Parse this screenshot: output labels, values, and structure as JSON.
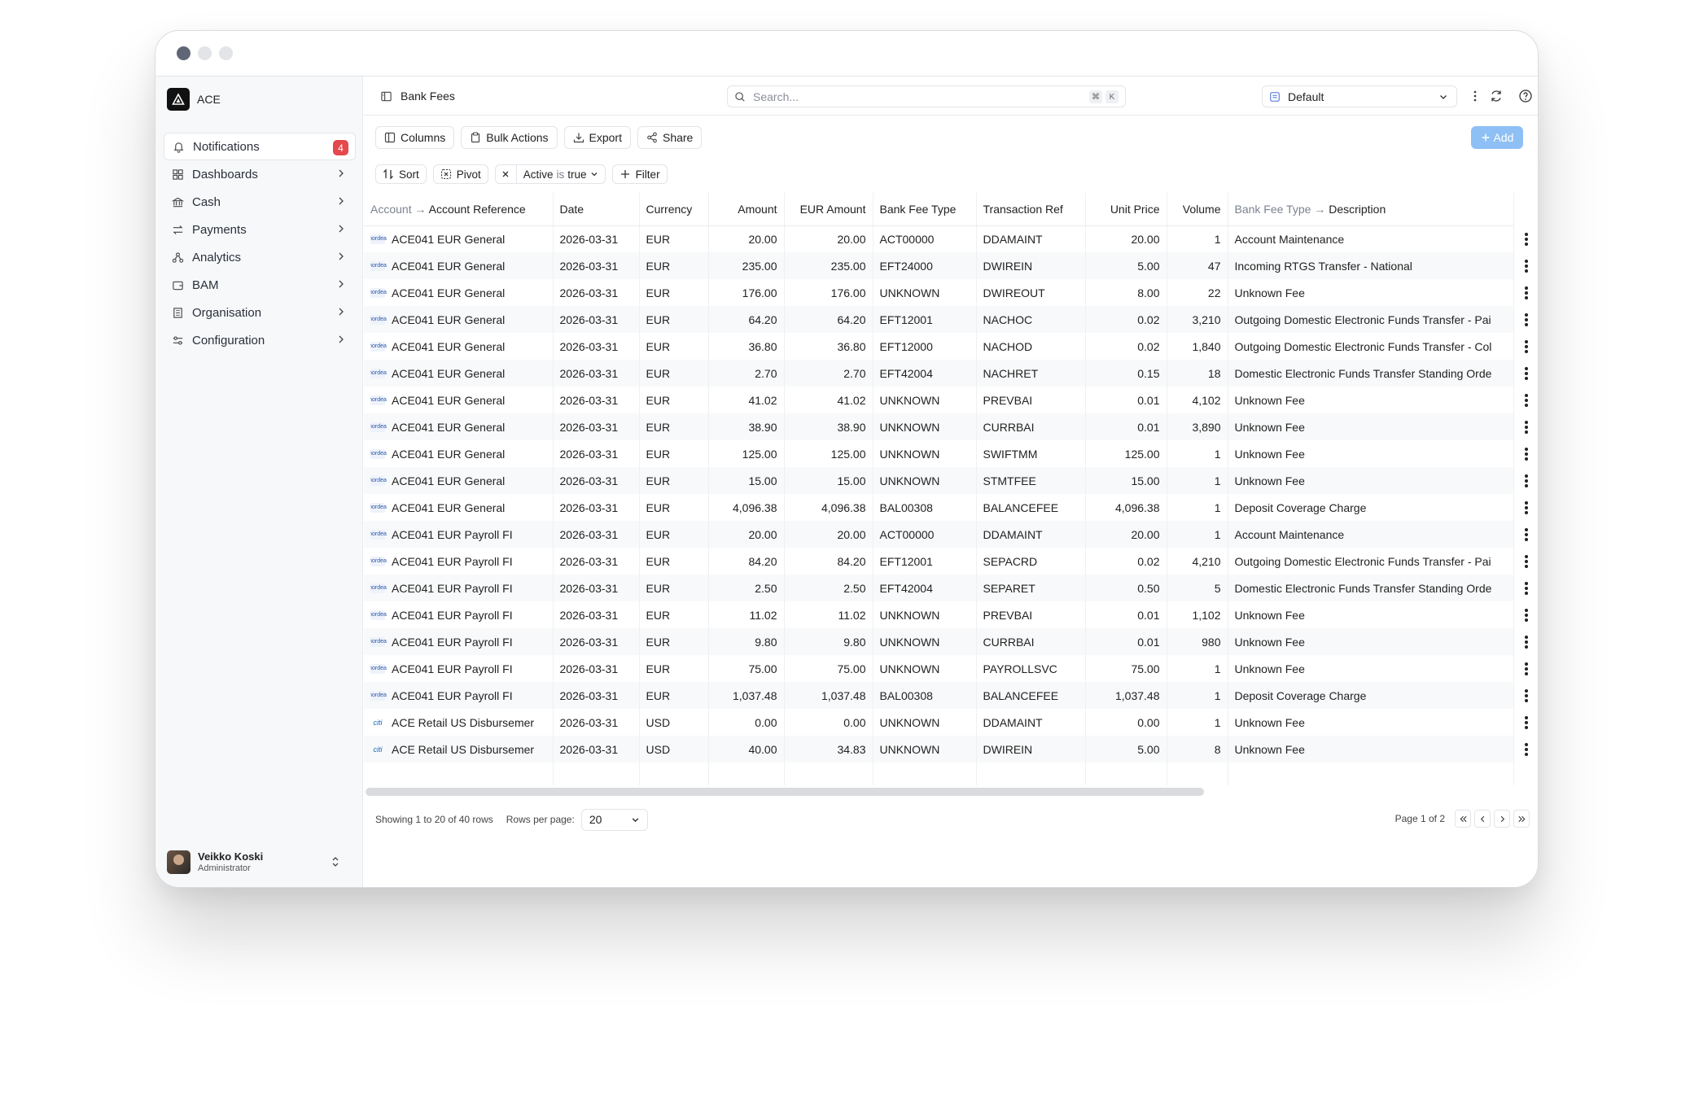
{
  "app": {
    "name": "ACE"
  },
  "sidebar": {
    "items": [
      {
        "label": "Notifications",
        "icon": "bell-icon",
        "badge": "4"
      },
      {
        "label": "Dashboards",
        "icon": "grid-icon"
      },
      {
        "label": "Cash",
        "icon": "bank-icon"
      },
      {
        "label": "Payments",
        "icon": "arrows-icon"
      },
      {
        "label": "Analytics",
        "icon": "analytics-icon"
      },
      {
        "label": "BAM",
        "icon": "wallet-icon"
      },
      {
        "label": "Organisation",
        "icon": "building-icon"
      },
      {
        "label": "Configuration",
        "icon": "sliders-icon"
      }
    ],
    "user": {
      "name": "Veikko Koski",
      "role": "Administrator"
    }
  },
  "header": {
    "title": "Bank Fees",
    "search_placeholder": "Search...",
    "shortcut_mod": "⌘",
    "shortcut_key": "K",
    "view": "Default"
  },
  "toolbar": {
    "columns": "Columns",
    "bulk_actions": "Bulk Actions",
    "export": "Export",
    "share": "Share",
    "add": "Add",
    "sort": "Sort",
    "pivot": "Pivot",
    "filter_field": "Active",
    "filter_op": "is",
    "filter_value": "true",
    "filter": "Filter"
  },
  "table": {
    "headers": {
      "account_prefix": "Account",
      "account": "Account Reference",
      "date": "Date",
      "currency": "Currency",
      "amount": "Amount",
      "eur_amount": "EUR Amount",
      "fee_type": "Bank Fee Type",
      "txn_ref": "Transaction Ref",
      "unit_price": "Unit Price",
      "volume": "Volume",
      "desc_prefix": "Bank Fee Type",
      "desc": "Description"
    },
    "rows": [
      {
        "bank": "nordea",
        "bank_label": "nordea",
        "account": "ACE041 EUR General",
        "date": "2026-03-31",
        "currency": "EUR",
        "amount": "20.00",
        "eur": "20.00",
        "fee_type": "ACT00000",
        "txn": "DDAMAINT",
        "unit": "20.00",
        "volume": "1",
        "desc": "Account Maintenance"
      },
      {
        "bank": "nordea",
        "bank_label": "nordea",
        "account": "ACE041 EUR General",
        "date": "2026-03-31",
        "currency": "EUR",
        "amount": "235.00",
        "eur": "235.00",
        "fee_type": "EFT24000",
        "txn": "DWIREIN",
        "unit": "5.00",
        "volume": "47",
        "desc": "Incoming RTGS Transfer - National"
      },
      {
        "bank": "nordea",
        "bank_label": "nordea",
        "account": "ACE041 EUR General",
        "date": "2026-03-31",
        "currency": "EUR",
        "amount": "176.00",
        "eur": "176.00",
        "fee_type": "UNKNOWN",
        "txn": "DWIREOUT",
        "unit": "8.00",
        "volume": "22",
        "desc": "Unknown Fee"
      },
      {
        "bank": "nordea",
        "bank_label": "nordea",
        "account": "ACE041 EUR General",
        "date": "2026-03-31",
        "currency": "EUR",
        "amount": "64.20",
        "eur": "64.20",
        "fee_type": "EFT12001",
        "txn": "NACHOC",
        "unit": "0.02",
        "volume": "3,210",
        "desc": "Outgoing Domestic Electronic Funds Transfer - Pai"
      },
      {
        "bank": "nordea",
        "bank_label": "nordea",
        "account": "ACE041 EUR General",
        "date": "2026-03-31",
        "currency": "EUR",
        "amount": "36.80",
        "eur": "36.80",
        "fee_type": "EFT12000",
        "txn": "NACHOD",
        "unit": "0.02",
        "volume": "1,840",
        "desc": "Outgoing Domestic Electronic Funds Transfer - Col"
      },
      {
        "bank": "nordea",
        "bank_label": "nordea",
        "account": "ACE041 EUR General",
        "date": "2026-03-31",
        "currency": "EUR",
        "amount": "2.70",
        "eur": "2.70",
        "fee_type": "EFT42004",
        "txn": "NACHRET",
        "unit": "0.15",
        "volume": "18",
        "desc": "Domestic Electronic Funds Transfer Standing Orde"
      },
      {
        "bank": "nordea",
        "bank_label": "nordea",
        "account": "ACE041 EUR General",
        "date": "2026-03-31",
        "currency": "EUR",
        "amount": "41.02",
        "eur": "41.02",
        "fee_type": "UNKNOWN",
        "txn": "PREVBAI",
        "unit": "0.01",
        "volume": "4,102",
        "desc": "Unknown Fee"
      },
      {
        "bank": "nordea",
        "bank_label": "nordea",
        "account": "ACE041 EUR General",
        "date": "2026-03-31",
        "currency": "EUR",
        "amount": "38.90",
        "eur": "38.90",
        "fee_type": "UNKNOWN",
        "txn": "CURRBAI",
        "unit": "0.01",
        "volume": "3,890",
        "desc": "Unknown Fee"
      },
      {
        "bank": "nordea",
        "bank_label": "nordea",
        "account": "ACE041 EUR General",
        "date": "2026-03-31",
        "currency": "EUR",
        "amount": "125.00",
        "eur": "125.00",
        "fee_type": "UNKNOWN",
        "txn": "SWIFTMM",
        "unit": "125.00",
        "volume": "1",
        "desc": "Unknown Fee"
      },
      {
        "bank": "nordea",
        "bank_label": "nordea",
        "account": "ACE041 EUR General",
        "date": "2026-03-31",
        "currency": "EUR",
        "amount": "15.00",
        "eur": "15.00",
        "fee_type": "UNKNOWN",
        "txn": "STMTFEE",
        "unit": "15.00",
        "volume": "1",
        "desc": "Unknown Fee"
      },
      {
        "bank": "nordea",
        "bank_label": "nordea",
        "account": "ACE041 EUR General",
        "date": "2026-03-31",
        "currency": "EUR",
        "amount": "4,096.38",
        "eur": "4,096.38",
        "fee_type": "BAL00308",
        "txn": "BALANCEFEE",
        "unit": "4,096.38",
        "volume": "1",
        "desc": "Deposit Coverage Charge"
      },
      {
        "bank": "nordea",
        "bank_label": "nordea",
        "account": "ACE041 EUR Payroll FI",
        "date": "2026-03-31",
        "currency": "EUR",
        "amount": "20.00",
        "eur": "20.00",
        "fee_type": "ACT00000",
        "txn": "DDAMAINT",
        "unit": "20.00",
        "volume": "1",
        "desc": "Account Maintenance"
      },
      {
        "bank": "nordea",
        "bank_label": "nordea",
        "account": "ACE041 EUR Payroll FI",
        "date": "2026-03-31",
        "currency": "EUR",
        "amount": "84.20",
        "eur": "84.20",
        "fee_type": "EFT12001",
        "txn": "SEPACRD",
        "unit": "0.02",
        "volume": "4,210",
        "desc": "Outgoing Domestic Electronic Funds Transfer - Pai"
      },
      {
        "bank": "nordea",
        "bank_label": "nordea",
        "account": "ACE041 EUR Payroll FI",
        "date": "2026-03-31",
        "currency": "EUR",
        "amount": "2.50",
        "eur": "2.50",
        "fee_type": "EFT42004",
        "txn": "SEPARET",
        "unit": "0.50",
        "volume": "5",
        "desc": "Domestic Electronic Funds Transfer Standing Orde"
      },
      {
        "bank": "nordea",
        "bank_label": "nordea",
        "account": "ACE041 EUR Payroll FI",
        "date": "2026-03-31",
        "currency": "EUR",
        "amount": "11.02",
        "eur": "11.02",
        "fee_type": "UNKNOWN",
        "txn": "PREVBAI",
        "unit": "0.01",
        "volume": "1,102",
        "desc": "Unknown Fee"
      },
      {
        "bank": "nordea",
        "bank_label": "nordea",
        "account": "ACE041 EUR Payroll FI",
        "date": "2026-03-31",
        "currency": "EUR",
        "amount": "9.80",
        "eur": "9.80",
        "fee_type": "UNKNOWN",
        "txn": "CURRBAI",
        "unit": "0.01",
        "volume": "980",
        "desc": "Unknown Fee"
      },
      {
        "bank": "nordea",
        "bank_label": "nordea",
        "account": "ACE041 EUR Payroll FI",
        "date": "2026-03-31",
        "currency": "EUR",
        "amount": "75.00",
        "eur": "75.00",
        "fee_type": "UNKNOWN",
        "txn": "PAYROLLSVC",
        "unit": "75.00",
        "volume": "1",
        "desc": "Unknown Fee"
      },
      {
        "bank": "nordea",
        "bank_label": "nordea",
        "account": "ACE041 EUR Payroll FI",
        "date": "2026-03-31",
        "currency": "EUR",
        "amount": "1,037.48",
        "eur": "1,037.48",
        "fee_type": "BAL00308",
        "txn": "BALANCEFEE",
        "unit": "1,037.48",
        "volume": "1",
        "desc": "Deposit Coverage Charge"
      },
      {
        "bank": "citi",
        "bank_label": "citi",
        "account": "ACE Retail US Disbursemer",
        "date": "2026-03-31",
        "currency": "USD",
        "amount": "0.00",
        "eur": "0.00",
        "fee_type": "UNKNOWN",
        "txn": "DDAMAINT",
        "unit": "0.00",
        "volume": "1",
        "desc": "Unknown Fee"
      },
      {
        "bank": "citi",
        "bank_label": "citi",
        "account": "ACE Retail US Disbursemer",
        "date": "2026-03-31",
        "currency": "USD",
        "amount": "40.00",
        "eur": "34.83",
        "fee_type": "UNKNOWN",
        "txn": "DWIREIN",
        "unit": "5.00",
        "volume": "8",
        "desc": "Unknown Fee"
      }
    ]
  },
  "footer": {
    "showing": "Showing 1 to 20 of 40 rows",
    "rows_per_page_label": "Rows per page:",
    "rows_per_page": "20",
    "page": "Page 1 of 2"
  }
}
